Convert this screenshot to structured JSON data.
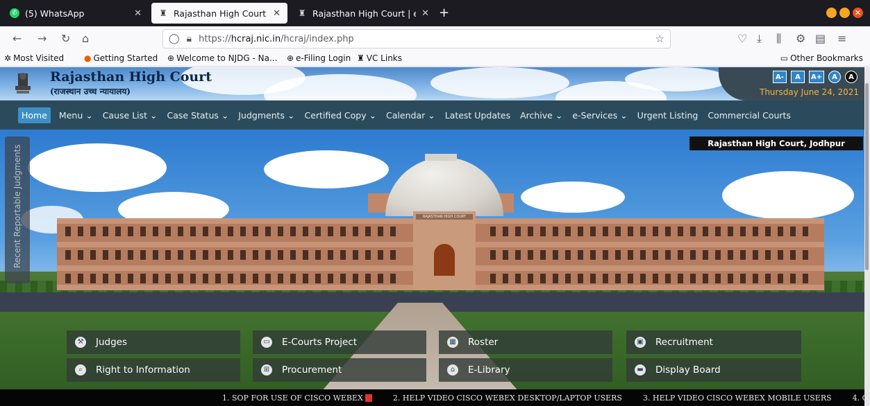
{
  "browser": {
    "tabs": [
      {
        "label": "(5) WhatsApp",
        "icon": "whatsapp-icon"
      },
      {
        "label": "Rajasthan High Court",
        "icon": "rhc-favicon"
      },
      {
        "label": "Rajasthan High Court | e-F",
        "icon": "rhc-favicon"
      }
    ],
    "url_scheme": "https://",
    "url_host": "hcraj.nic.in",
    "url_path": "/hcraj/index.php",
    "bookmarks": [
      {
        "label": "Most Visited"
      },
      {
        "label": "Getting Started"
      },
      {
        "label": "Welcome to NJDG - Na..."
      },
      {
        "label": "e-Filing Login"
      },
      {
        "label": "VC Links"
      }
    ],
    "other_bookmarks": "Other Bookmarks"
  },
  "header": {
    "title": "Rajasthan High Court",
    "subtitle": "(राजस्थान उच्च न्यायालय)",
    "font_buttons": [
      "A-",
      "A",
      "A+"
    ],
    "contrast_buttons": [
      "A",
      "A"
    ],
    "date": "Thursday June 24, 2021"
  },
  "menu": [
    {
      "label": "Home"
    },
    {
      "label": "Menu ⌄"
    },
    {
      "label": "Cause List ⌄"
    },
    {
      "label": "Case Status ⌄"
    },
    {
      "label": "Judgments ⌄"
    },
    {
      "label": "Certified Copy ⌄"
    },
    {
      "label": "Calendar ⌄"
    },
    {
      "label": "Latest Updates"
    },
    {
      "label": "Archive ⌄"
    },
    {
      "label": "e-Services ⌄"
    },
    {
      "label": "Urgent Listing"
    },
    {
      "label": "Commercial Courts"
    }
  ],
  "hero": {
    "location_badge": "Rajasthan High Court, Jodhpur",
    "side_tab": "Recent Reportable Judgments",
    "building_sign": "RAJASTHAN HIGH COURT"
  },
  "quick_links": [
    {
      "label": "Judges",
      "icon": "gavel-icon"
    },
    {
      "label": "E-Courts Project",
      "icon": "monitor-icon"
    },
    {
      "label": "Roster",
      "icon": "calendar-icon"
    },
    {
      "label": "Recruitment",
      "icon": "id-card-icon"
    },
    {
      "label": "Right to Information",
      "icon": "search-icon"
    },
    {
      "label": "Procurement",
      "icon": "cart-icon"
    },
    {
      "label": "E-Library",
      "icon": "library-icon"
    },
    {
      "label": "Display Board",
      "icon": "board-icon"
    }
  ],
  "ticker": [
    "1. SOP FOR USE OF CISCO WEBEX",
    "2. HELP VIDEO CISCO WEBEX DESKTOP/LAPTOP USERS",
    "3. HELP VIDEO CISCO WEBEX MOBILE USERS",
    "4. C"
  ],
  "colors": {
    "menu_bg": "#2b4b5c",
    "home_active": "#3d8fc6",
    "date_text": "#f2b441",
    "title_text": "#0b2447"
  }
}
